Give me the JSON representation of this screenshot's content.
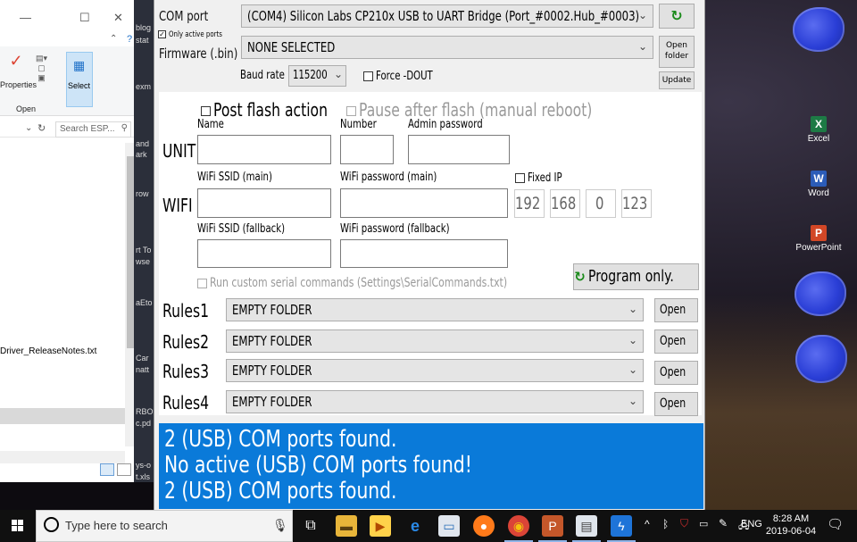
{
  "explorer": {
    "ribbon_properties": "Properties",
    "ribbon_open": "Open",
    "ribbon_select": "Select",
    "search_placeholder": "Search ESP...",
    "file_name": "Driver_ReleaseNotes.txt"
  },
  "strip_fragments": [
    "blog",
    "stat",
    "exm",
    "and",
    "ark",
    "row",
    "rt To",
    "wse",
    "aEto",
    "Car",
    "natt",
    "RBO",
    "c.pd",
    "ys-o",
    "t.xls"
  ],
  "flasher": {
    "com_port_label": "COM port",
    "com_port_value": "(COM4) Silicon Labs CP210x USB to UART Bridge (Port_#0002.Hub_#0003)",
    "only_active_ports": "Only active ports",
    "only_active_checked": true,
    "firmware_label": "Firmware (.bin)",
    "firmware_value": "NONE SELECTED",
    "open_folder_btn": "Open folder",
    "update_btn": "Update",
    "baud_label": "Baud rate",
    "baud_value": "115200",
    "force_dout": "Force -DOUT",
    "post_flash": "Post flash action",
    "pause_after_flash": "Pause after flash (manual reboot)",
    "unit_label": "UNIT",
    "name_label": "Name",
    "number_label": "Number",
    "admin_password_label": "Admin password",
    "wifi_label": "WIFI",
    "wifi_ssid_main": "WiFi SSID (main)",
    "wifi_pw_main": "WiFi password (main)",
    "fixed_ip": "Fixed IP",
    "ip": [
      "192",
      "168",
      "0",
      "123"
    ],
    "wifi_ssid_fallback": "WiFi SSID (fallback)",
    "wifi_pw_fallback": "WiFi password (fallback)",
    "program_only_btn": "Program only.",
    "run_custom_serial": "Run custom serial commands (Settings\\SerialCommands.txt)",
    "rules": [
      {
        "label": "Rules1",
        "value": "EMPTY FOLDER",
        "btn": "Open"
      },
      {
        "label": "Rules2",
        "value": "EMPTY FOLDER",
        "btn": "Open"
      },
      {
        "label": "Rules3",
        "value": "EMPTY FOLDER",
        "btn": "Open"
      },
      {
        "label": "Rules4",
        "value": "EMPTY FOLDER",
        "btn": "Open"
      }
    ],
    "log_lines": [
      "2 (USB) COM ports found.",
      "No active (USB) COM ports found!",
      "2 (USB) COM ports found."
    ]
  },
  "desktop_icons": [
    {
      "label": "Excel",
      "color": "#1d7a45",
      "glyph": "X"
    },
    {
      "label": "Word",
      "color": "#2b5cb8",
      "glyph": "W"
    },
    {
      "label": "PowerPoint",
      "color": "#d24726",
      "glyph": "P"
    }
  ],
  "taskbar": {
    "search_text": "Type here to search",
    "language": "ENG",
    "time": "8:28 AM",
    "date": "2019-06-04"
  }
}
